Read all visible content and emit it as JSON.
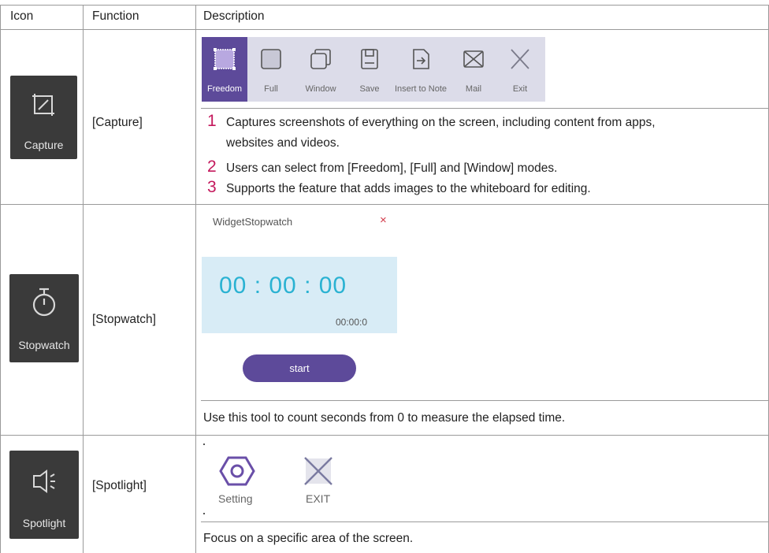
{
  "header": {
    "icon": "Icon",
    "function": "Function",
    "description": "Description"
  },
  "rows": [
    {
      "icon_label": "Capture",
      "icon_name": "capture-crop-icon",
      "function": "[Capture]",
      "toolbar": [
        {
          "label": "Freedom",
          "icon": "freedom-select-icon",
          "active": true
        },
        {
          "label": "Full",
          "icon": "full-screen-icon"
        },
        {
          "label": "Window",
          "icon": "window-icon"
        },
        {
          "label": "Save",
          "icon": "save-icon"
        },
        {
          "label": "Insert to Note",
          "icon": "insert-to-note-icon"
        },
        {
          "label": "Mail",
          "icon": "mail-icon"
        },
        {
          "label": "Exit",
          "icon": "exit-icon"
        }
      ],
      "items": [
        {
          "num": "1",
          "text_line1": "Captures screenshots of everything on the screen, including content from apps,",
          "text_line2": "websites and videos."
        },
        {
          "num": "2",
          "text_line1": "Users can select from [Freedom], [Full] and [Window] modes."
        },
        {
          "num": "3",
          "text_line1": "Supports the feature that adds images to the whiteboard for editing."
        }
      ]
    },
    {
      "icon_label": "Stopwatch",
      "icon_name": "stopwatch-icon",
      "function": "[Stopwatch]",
      "widget": {
        "title": "WidgetStopwatch",
        "close": "×",
        "digits": "00 : 00 : 00",
        "sub_time": "00:00:0",
        "start": "start"
      },
      "description": "Use this tool to count seconds from 0 to measure the elapsed time."
    },
    {
      "icon_label": "Spotlight",
      "icon_name": "spotlight-icon",
      "function": "[Spotlight]",
      "buttons": [
        {
          "label": "Setting",
          "icon": "hexagon-setting-icon"
        },
        {
          "label": "EXIT",
          "icon": "exit-icon"
        }
      ],
      "description": "Focus on a specific area of the screen."
    }
  ],
  "colors": {
    "accent_purple": "#5d4a9a",
    "number_red": "#c4185c",
    "digit_blue": "#2ab2d2",
    "panel_blue": "#d8ecf6",
    "toolbar_bg": "#dcdce9",
    "tile_bg": "#3a3a3a"
  }
}
